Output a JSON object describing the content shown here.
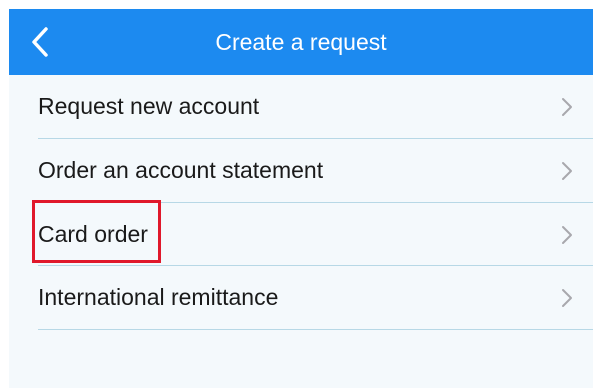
{
  "header": {
    "title": "Create a request",
    "back_icon": "chevron-left-icon",
    "background_color": "#1c8af0"
  },
  "list": {
    "items": [
      {
        "label": "Request new account",
        "icon": "chevron-right-icon"
      },
      {
        "label": "Order an account statement",
        "icon": "chevron-right-icon"
      },
      {
        "label": "Card order",
        "icon": "chevron-right-icon",
        "highlighted": true
      },
      {
        "label": "International remittance",
        "icon": "chevron-right-icon"
      }
    ]
  },
  "colors": {
    "list_background": "#f4f9fc",
    "divider": "#b7d8e6",
    "highlight_border": "#e0182b",
    "chevron": "#a8a8ad"
  }
}
